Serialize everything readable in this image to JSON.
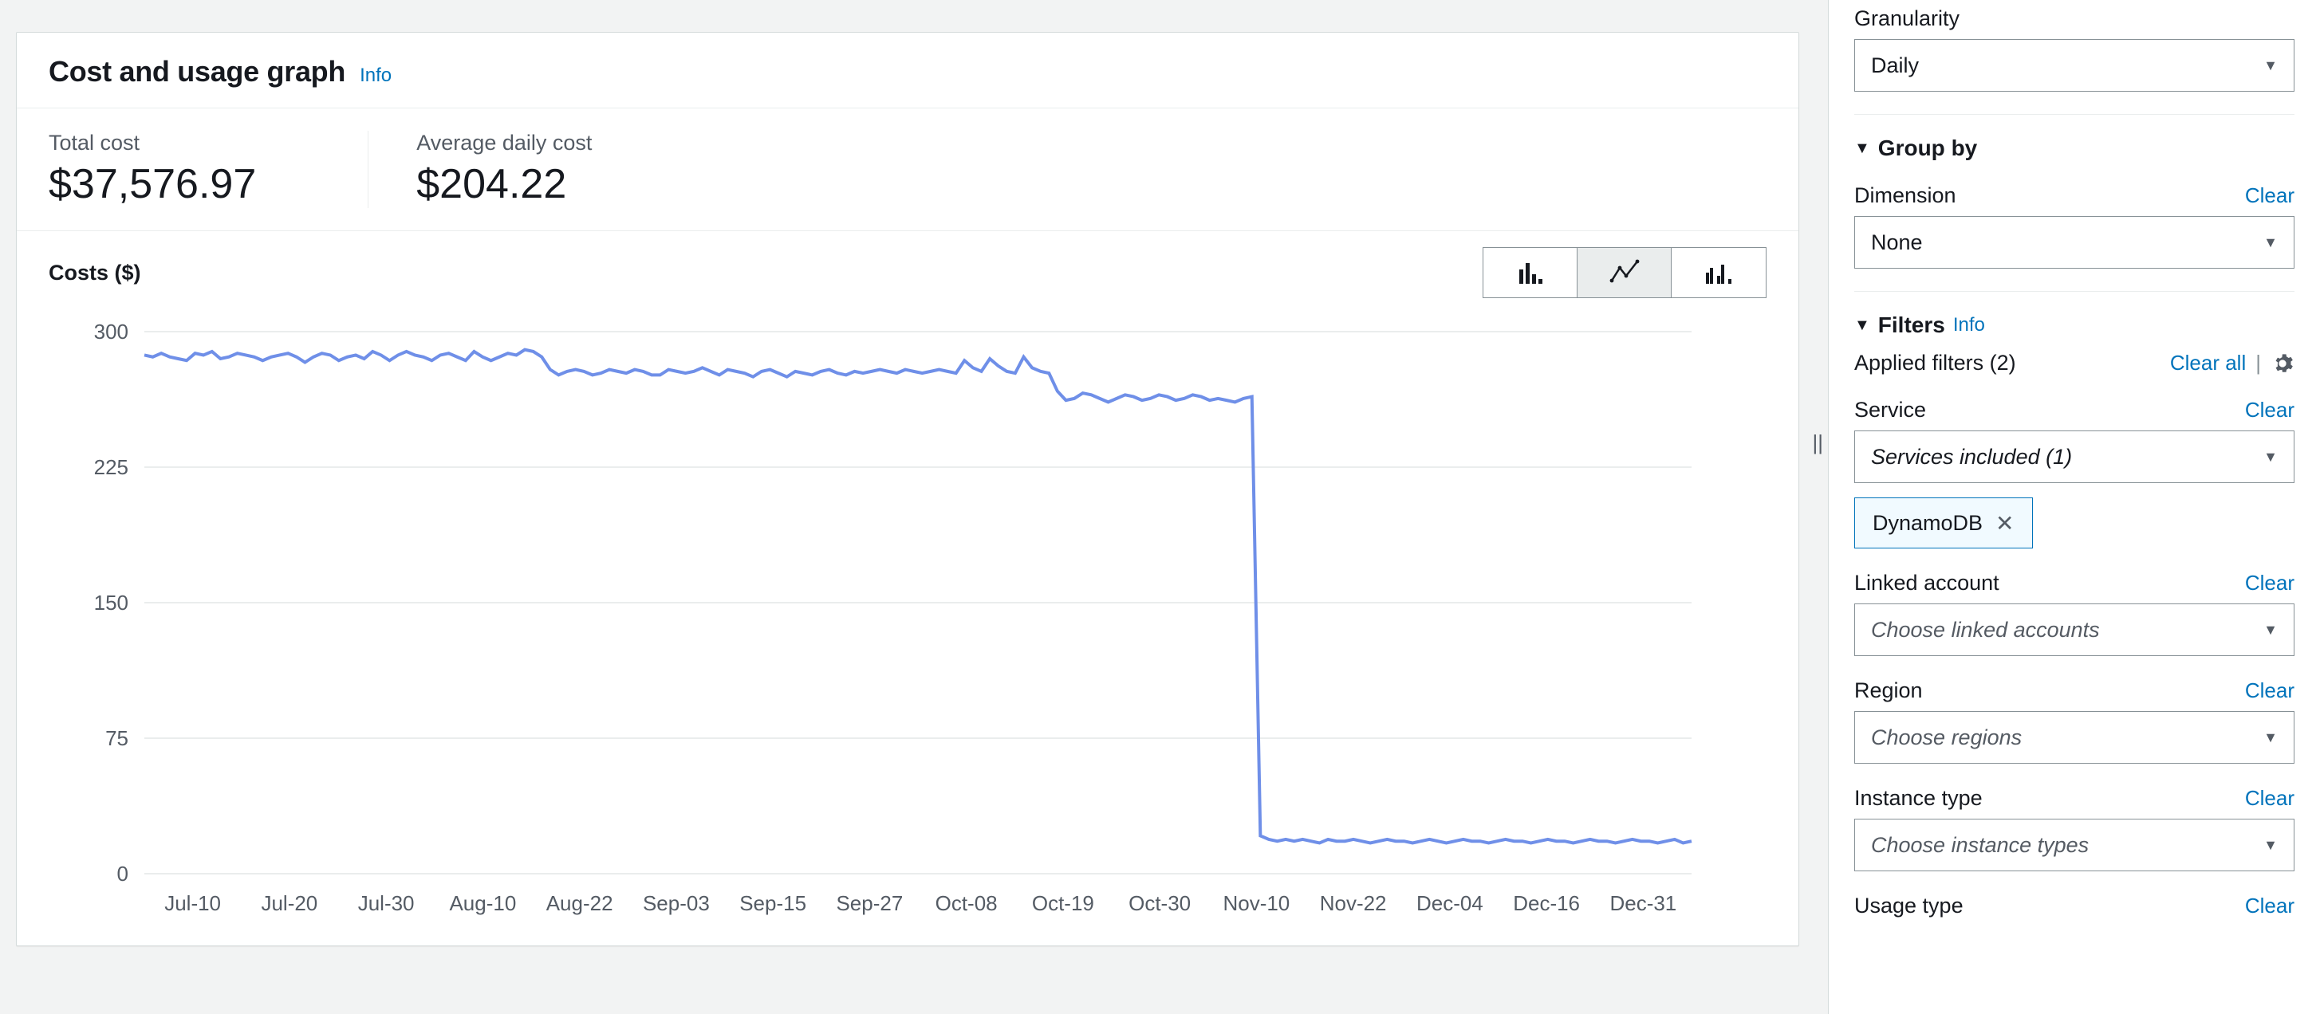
{
  "header": {
    "title": "Cost and usage graph",
    "info": "Info"
  },
  "metrics": {
    "total_label": "Total cost",
    "total_value": "$37,576.97",
    "avg_label": "Average daily cost",
    "avg_value": "$204.22"
  },
  "chart_controls": {
    "y_title": "Costs ($)",
    "modes": {
      "bar": "bar-chart-icon",
      "line": "line-chart-icon",
      "grouped": "grouped-bar-icon"
    },
    "selected": "line"
  },
  "chart_data": {
    "type": "line",
    "title": "Costs ($)",
    "xlabel": "",
    "ylabel": "Costs ($)",
    "ylim": [
      0,
      300
    ],
    "y_ticks": [
      0,
      75,
      150,
      225,
      300
    ],
    "x_tick_labels": [
      "Jul-10",
      "Jul-20",
      "Jul-30",
      "Aug-10",
      "Aug-22",
      "Sep-03",
      "Sep-15",
      "Sep-27",
      "Oct-08",
      "Oct-19",
      "Oct-30",
      "Nov-10",
      "Nov-22",
      "Dec-04",
      "Dec-16",
      "Dec-31"
    ],
    "series": [
      {
        "name": "Costs",
        "color": "#6f8fe8",
        "x": [
          "Jul-01",
          "Jul-02",
          "Jul-03",
          "Jul-04",
          "Jul-05",
          "Jul-06",
          "Jul-07",
          "Jul-08",
          "Jul-09",
          "Jul-10",
          "Jul-11",
          "Jul-12",
          "Jul-13",
          "Jul-14",
          "Jul-15",
          "Jul-16",
          "Jul-17",
          "Jul-18",
          "Jul-19",
          "Jul-20",
          "Jul-21",
          "Jul-22",
          "Jul-23",
          "Jul-24",
          "Jul-25",
          "Jul-26",
          "Jul-27",
          "Jul-28",
          "Jul-29",
          "Jul-30",
          "Jul-31",
          "Aug-01",
          "Aug-02",
          "Aug-03",
          "Aug-04",
          "Aug-05",
          "Aug-06",
          "Aug-07",
          "Aug-08",
          "Aug-09",
          "Aug-10",
          "Aug-11",
          "Aug-12",
          "Aug-13",
          "Aug-14",
          "Aug-15",
          "Aug-16",
          "Aug-17",
          "Aug-18",
          "Aug-19",
          "Aug-20",
          "Aug-21",
          "Aug-22",
          "Aug-23",
          "Aug-24",
          "Aug-25",
          "Aug-26",
          "Aug-27",
          "Aug-28",
          "Aug-29",
          "Aug-30",
          "Aug-31",
          "Sep-01",
          "Sep-02",
          "Sep-03",
          "Sep-04",
          "Sep-05",
          "Sep-06",
          "Sep-07",
          "Sep-08",
          "Sep-09",
          "Sep-10",
          "Sep-11",
          "Sep-12",
          "Sep-13",
          "Sep-14",
          "Sep-15",
          "Sep-16",
          "Sep-17",
          "Sep-18",
          "Sep-19",
          "Sep-20",
          "Sep-21",
          "Sep-22",
          "Sep-23",
          "Sep-24",
          "Sep-25",
          "Sep-26",
          "Sep-27",
          "Sep-28",
          "Sep-29",
          "Sep-30",
          "Oct-01",
          "Oct-02",
          "Oct-03",
          "Oct-04",
          "Oct-05",
          "Oct-06",
          "Oct-07",
          "Oct-08",
          "Oct-09",
          "Oct-10",
          "Oct-11",
          "Oct-12",
          "Oct-13",
          "Oct-14",
          "Oct-15",
          "Oct-16",
          "Oct-17",
          "Oct-18",
          "Oct-19",
          "Oct-20",
          "Oct-21",
          "Oct-22",
          "Oct-23",
          "Oct-24",
          "Oct-25",
          "Oct-26",
          "Oct-27",
          "Oct-28",
          "Oct-29",
          "Oct-30",
          "Oct-31",
          "Nov-01",
          "Nov-02",
          "Nov-03",
          "Nov-04",
          "Nov-05",
          "Nov-06",
          "Nov-07",
          "Nov-08",
          "Nov-09",
          "Nov-10",
          "Nov-11",
          "Nov-12",
          "Nov-13",
          "Nov-14",
          "Nov-15",
          "Nov-16",
          "Nov-17",
          "Nov-18",
          "Nov-19",
          "Nov-20",
          "Nov-21",
          "Nov-22",
          "Nov-23",
          "Nov-24",
          "Nov-25",
          "Nov-26",
          "Nov-27",
          "Nov-28",
          "Nov-29",
          "Nov-30",
          "Dec-01",
          "Dec-02",
          "Dec-03",
          "Dec-04",
          "Dec-05",
          "Dec-06",
          "Dec-07",
          "Dec-08",
          "Dec-09",
          "Dec-10",
          "Dec-11",
          "Dec-12",
          "Dec-13",
          "Dec-14",
          "Dec-15",
          "Dec-16",
          "Dec-17",
          "Dec-18",
          "Dec-19",
          "Dec-20",
          "Dec-21",
          "Dec-22",
          "Dec-23",
          "Dec-24",
          "Dec-25",
          "Dec-26",
          "Dec-27",
          "Dec-28",
          "Dec-29",
          "Dec-30",
          "Dec-31"
        ],
        "values": [
          287,
          286,
          288,
          286,
          285,
          284,
          288,
          287,
          289,
          285,
          286,
          288,
          287,
          286,
          284,
          286,
          287,
          288,
          286,
          283,
          286,
          288,
          287,
          284,
          286,
          287,
          285,
          289,
          287,
          284,
          287,
          289,
          287,
          286,
          284,
          287,
          288,
          286,
          284,
          289,
          286,
          284,
          286,
          288,
          287,
          290,
          289,
          286,
          279,
          276,
          278,
          279,
          278,
          276,
          277,
          279,
          278,
          277,
          279,
          278,
          276,
          276,
          279,
          278,
          277,
          278,
          280,
          278,
          276,
          279,
          278,
          277,
          275,
          278,
          279,
          277,
          275,
          278,
          277,
          276,
          278,
          279,
          277,
          276,
          278,
          277,
          278,
          279,
          278,
          277,
          279,
          278,
          277,
          278,
          279,
          278,
          277,
          284,
          280,
          278,
          285,
          281,
          278,
          277,
          286,
          280,
          278,
          277,
          267,
          262,
          263,
          266,
          265,
          263,
          261,
          263,
          265,
          264,
          262,
          263,
          265,
          264,
          262,
          263,
          265,
          264,
          262,
          263,
          262,
          261,
          263,
          264,
          21,
          19,
          18,
          19,
          18,
          19,
          18,
          17,
          19,
          18,
          18,
          19,
          18,
          17,
          18,
          19,
          18,
          18,
          17,
          18,
          19,
          18,
          17,
          18,
          19,
          18,
          18,
          17,
          18,
          19,
          18,
          18,
          17,
          18,
          19,
          18,
          18,
          17,
          18,
          19,
          18,
          18,
          17,
          18,
          19,
          18,
          18,
          17,
          18,
          19,
          17,
          18
        ]
      }
    ]
  },
  "side": {
    "granularity": {
      "label": "Granularity",
      "value": "Daily"
    },
    "group_by": {
      "label": "Group by",
      "dimension_label": "Dimension",
      "clear": "Clear",
      "value": "None"
    },
    "filters": {
      "label": "Filters",
      "info": "Info",
      "applied_label": "Applied filters (2)",
      "clear_all": "Clear all",
      "service": {
        "label": "Service",
        "clear": "Clear",
        "placeholder": "Services included (1)",
        "chip": "DynamoDB"
      },
      "linked_account": {
        "label": "Linked account",
        "clear": "Clear",
        "placeholder": "Choose linked accounts"
      },
      "region": {
        "label": "Region",
        "clear": "Clear",
        "placeholder": "Choose regions"
      },
      "instance_type": {
        "label": "Instance type",
        "clear": "Clear",
        "placeholder": "Choose instance types"
      },
      "usage_type": {
        "label": "Usage type",
        "clear": "Clear"
      }
    }
  }
}
